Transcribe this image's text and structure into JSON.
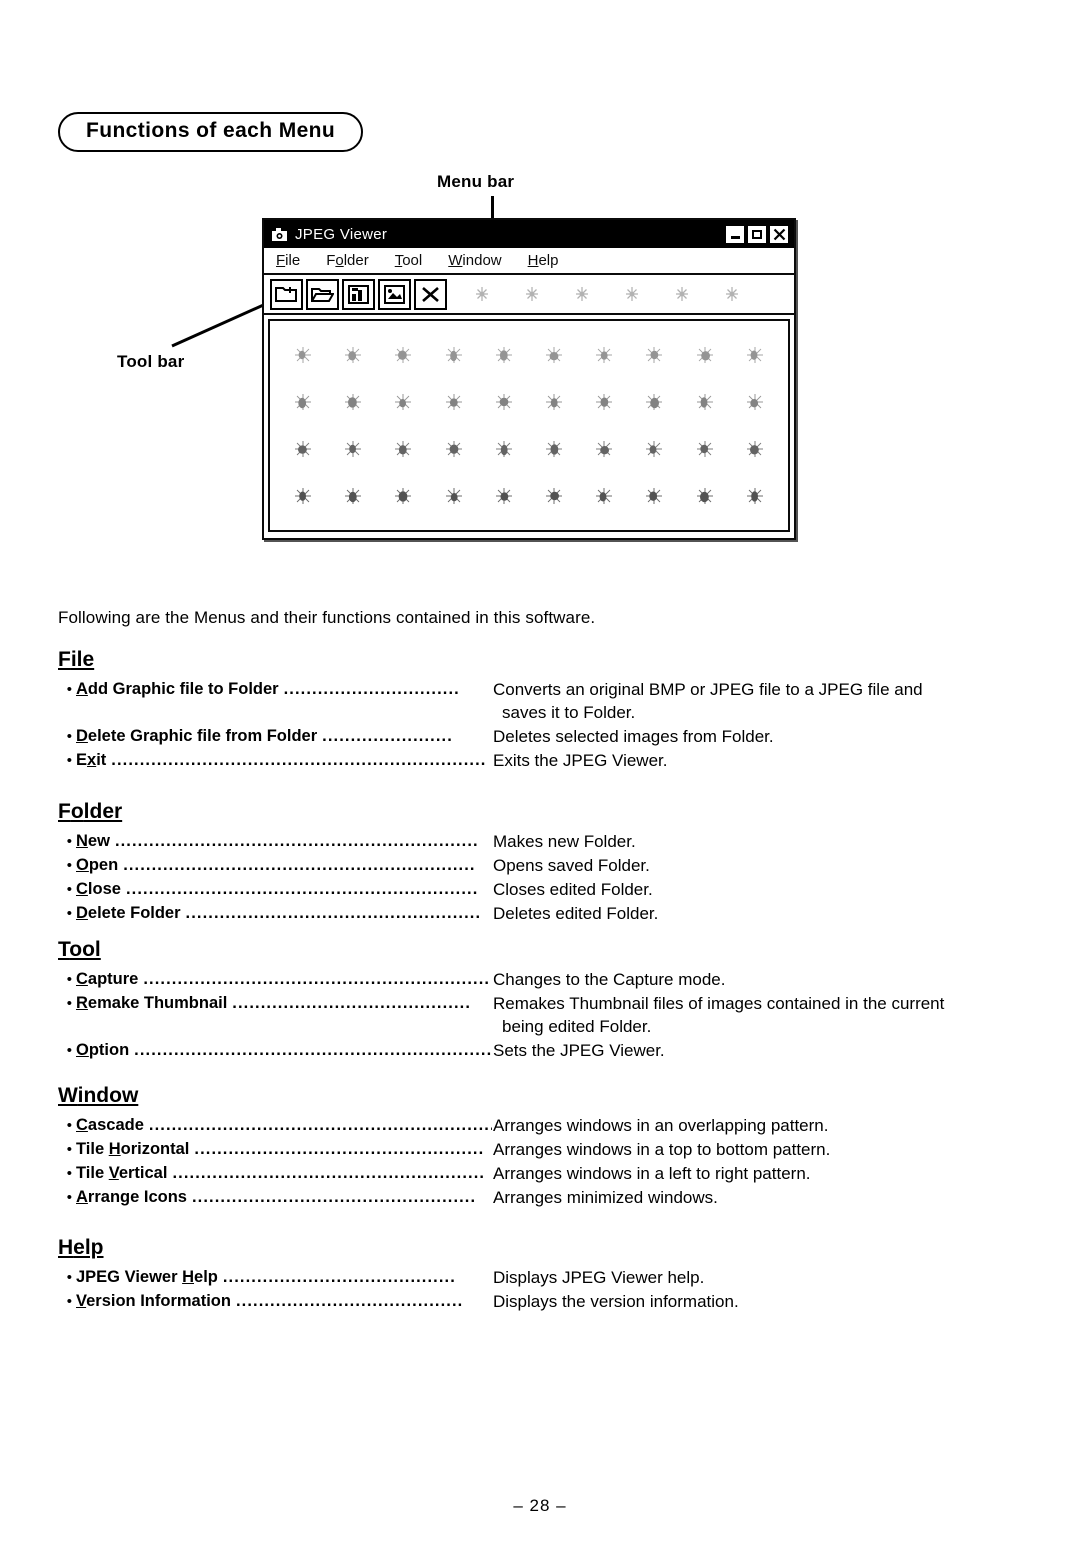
{
  "page": {
    "section_title": "Functions of each Menu",
    "intro": "Following are the Menus and their functions contained in this software.",
    "page_number": "– 28 –"
  },
  "callouts": {
    "menu_bar": "Menu bar",
    "tool_bar": "Tool bar"
  },
  "app_window": {
    "title": "JPEG Viewer",
    "title_icon": "camera-icon",
    "window_buttons": [
      {
        "name": "minimize-button",
        "glyph": "minimize-icon"
      },
      {
        "name": "maximize-button",
        "glyph": "maximize-icon"
      },
      {
        "name": "close-button",
        "glyph": "close-icon",
        "label": "✕"
      }
    ],
    "menus": [
      {
        "mnemonic": "F",
        "rest": "ile"
      },
      {
        "pre": "F",
        "mnemonic": "o",
        "rest": "lder"
      },
      {
        "mnemonic": "T",
        "rest": "ool"
      },
      {
        "mnemonic": "W",
        "rest": "indow"
      },
      {
        "mnemonic": "H",
        "rest": "elp"
      }
    ],
    "toolbar_buttons": [
      "new-folder-icon",
      "open-folder-icon",
      "add-graphic-icon",
      "capture-icon",
      "delete-icon"
    ],
    "ghost_icon_count": 6,
    "thumbnail_grid": {
      "columns": 10,
      "rows": 4
    }
  },
  "sections": [
    {
      "id": "file",
      "heading": "File",
      "heading_mnemonic": "F",
      "heading_rest": "ile",
      "entries": [
        {
          "mnemonic": "A",
          "pre": "",
          "rest": "dd Graphic file to Folder",
          "dots": "...............................",
          "desc": "Converts an original BMP or JPEG file to a JPEG file and",
          "desc_cont": "saves it to Folder."
        },
        {
          "mnemonic": "D",
          "pre": "",
          "rest": "elete Graphic file from Folder",
          "dots": ".......................",
          "desc": "Deletes selected images from Folder.",
          "desc_cont": ""
        },
        {
          "mnemonic": "x",
          "pre": "E",
          "rest": "it",
          "dots": "..................................................................",
          "desc": "Exits the JPEG Viewer.",
          "desc_cont": ""
        }
      ]
    },
    {
      "id": "folder",
      "heading": "Folder",
      "heading_mnemonic": "o",
      "heading_pre": "F",
      "heading_rest": "lder",
      "entries": [
        {
          "mnemonic": "N",
          "pre": "",
          "rest": "ew",
          "dots": "................................................................",
          "desc": "Makes new Folder.",
          "desc_cont": ""
        },
        {
          "mnemonic": "O",
          "pre": "",
          "rest": "pen",
          "dots": "..............................................................",
          "desc": "Opens saved Folder.",
          "desc_cont": ""
        },
        {
          "mnemonic": "C",
          "pre": "",
          "rest": "lose",
          "dots": "..............................................................",
          "desc": "Closes edited Folder.",
          "desc_cont": ""
        },
        {
          "mnemonic": "D",
          "pre": "",
          "rest": "elete Folder",
          "dots": "....................................................",
          "desc": "Deletes edited Folder.",
          "desc_cont": ""
        }
      ]
    },
    {
      "id": "tool",
      "heading": "Tool",
      "heading_mnemonic": "T",
      "heading_rest": "ool",
      "entries": [
        {
          "mnemonic": "C",
          "pre": "",
          "rest": "apture",
          "dots": ".............................................................",
          "desc": "Changes to the Capture mode.",
          "desc_cont": ""
        },
        {
          "mnemonic": "R",
          "pre": "",
          "rest": "emake Thumbnail",
          "dots": "..........................................",
          "desc": "Remakes Thumbnail files of images contained in the current",
          "desc_cont": "being edited Folder."
        },
        {
          "mnemonic": "O",
          "pre": "",
          "rest": "ption",
          "dots": "...............................................................",
          "desc": "Sets the JPEG Viewer.",
          "desc_cont": ""
        }
      ]
    },
    {
      "id": "window",
      "heading": "Window",
      "heading_mnemonic": "W",
      "heading_rest": "indow",
      "entries": [
        {
          "mnemonic": "C",
          "pre": "",
          "rest": "ascade",
          "dots": ".............................................................",
          "desc": "Arranges windows in an overlapping pattern.",
          "desc_cont": ""
        },
        {
          "mnemonic": "H",
          "pre": "Tile ",
          "rest": "orizontal",
          "dots": "...................................................",
          "desc": "Arranges windows in a top to bottom pattern.",
          "desc_cont": ""
        },
        {
          "mnemonic": "V",
          "pre": "Tile ",
          "rest": "ertical",
          "dots": ".......................................................",
          "desc": "Arranges windows in a left to right pattern.",
          "desc_cont": ""
        },
        {
          "mnemonic": "A",
          "pre": "",
          "rest": "rrange Icons",
          "dots": "..................................................",
          "desc": "Arranges minimized windows.",
          "desc_cont": ""
        }
      ]
    },
    {
      "id": "help",
      "heading": "Help",
      "heading_mnemonic": "H",
      "heading_rest": "elp",
      "entries": [
        {
          "mnemonic": "H",
          "pre": "JPEG Viewer ",
          "rest": "elp",
          "dots": ".........................................",
          "desc": "Displays JPEG Viewer help.",
          "desc_cont": ""
        },
        {
          "mnemonic": "V",
          "pre": "",
          "rest": "ersion Information",
          "dots": "........................................",
          "desc": "Displays the version information.",
          "desc_cont": ""
        }
      ]
    }
  ]
}
